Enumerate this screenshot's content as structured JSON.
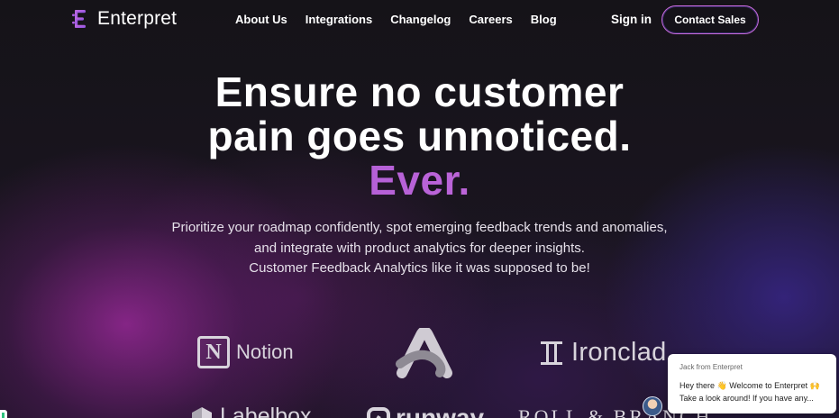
{
  "nav": {
    "brand": "Enterpret",
    "links": [
      "About Us",
      "Integrations",
      "Changelog",
      "Careers",
      "Blog"
    ],
    "signin": "Sign in",
    "cta": "Contact Sales"
  },
  "hero": {
    "line1": "Ensure no customer",
    "line2": "pain goes unnoticed.",
    "highlight": "Ever.",
    "accent_color": "#b45cd6"
  },
  "subtitle": {
    "line1": "Prioritize your roadmap confidently, spot emerging feedback trends and anomalies,",
    "line2": "and integrate with product analytics for deeper insights.",
    "line3": "Customer Feedback Analytics like it was supposed to be!"
  },
  "logos": {
    "notion": "Notion",
    "ironclad": "Ironclad",
    "labelbox": "Labelbox",
    "runway": "runway",
    "rollbranch": "ROLL & BRANCH"
  },
  "chat": {
    "from": "Jack from Enterpret",
    "message_line1": "Hey there 👋 Welcome to Enterpret 🙌",
    "message_line2": "Take a look around! If you have any..."
  }
}
